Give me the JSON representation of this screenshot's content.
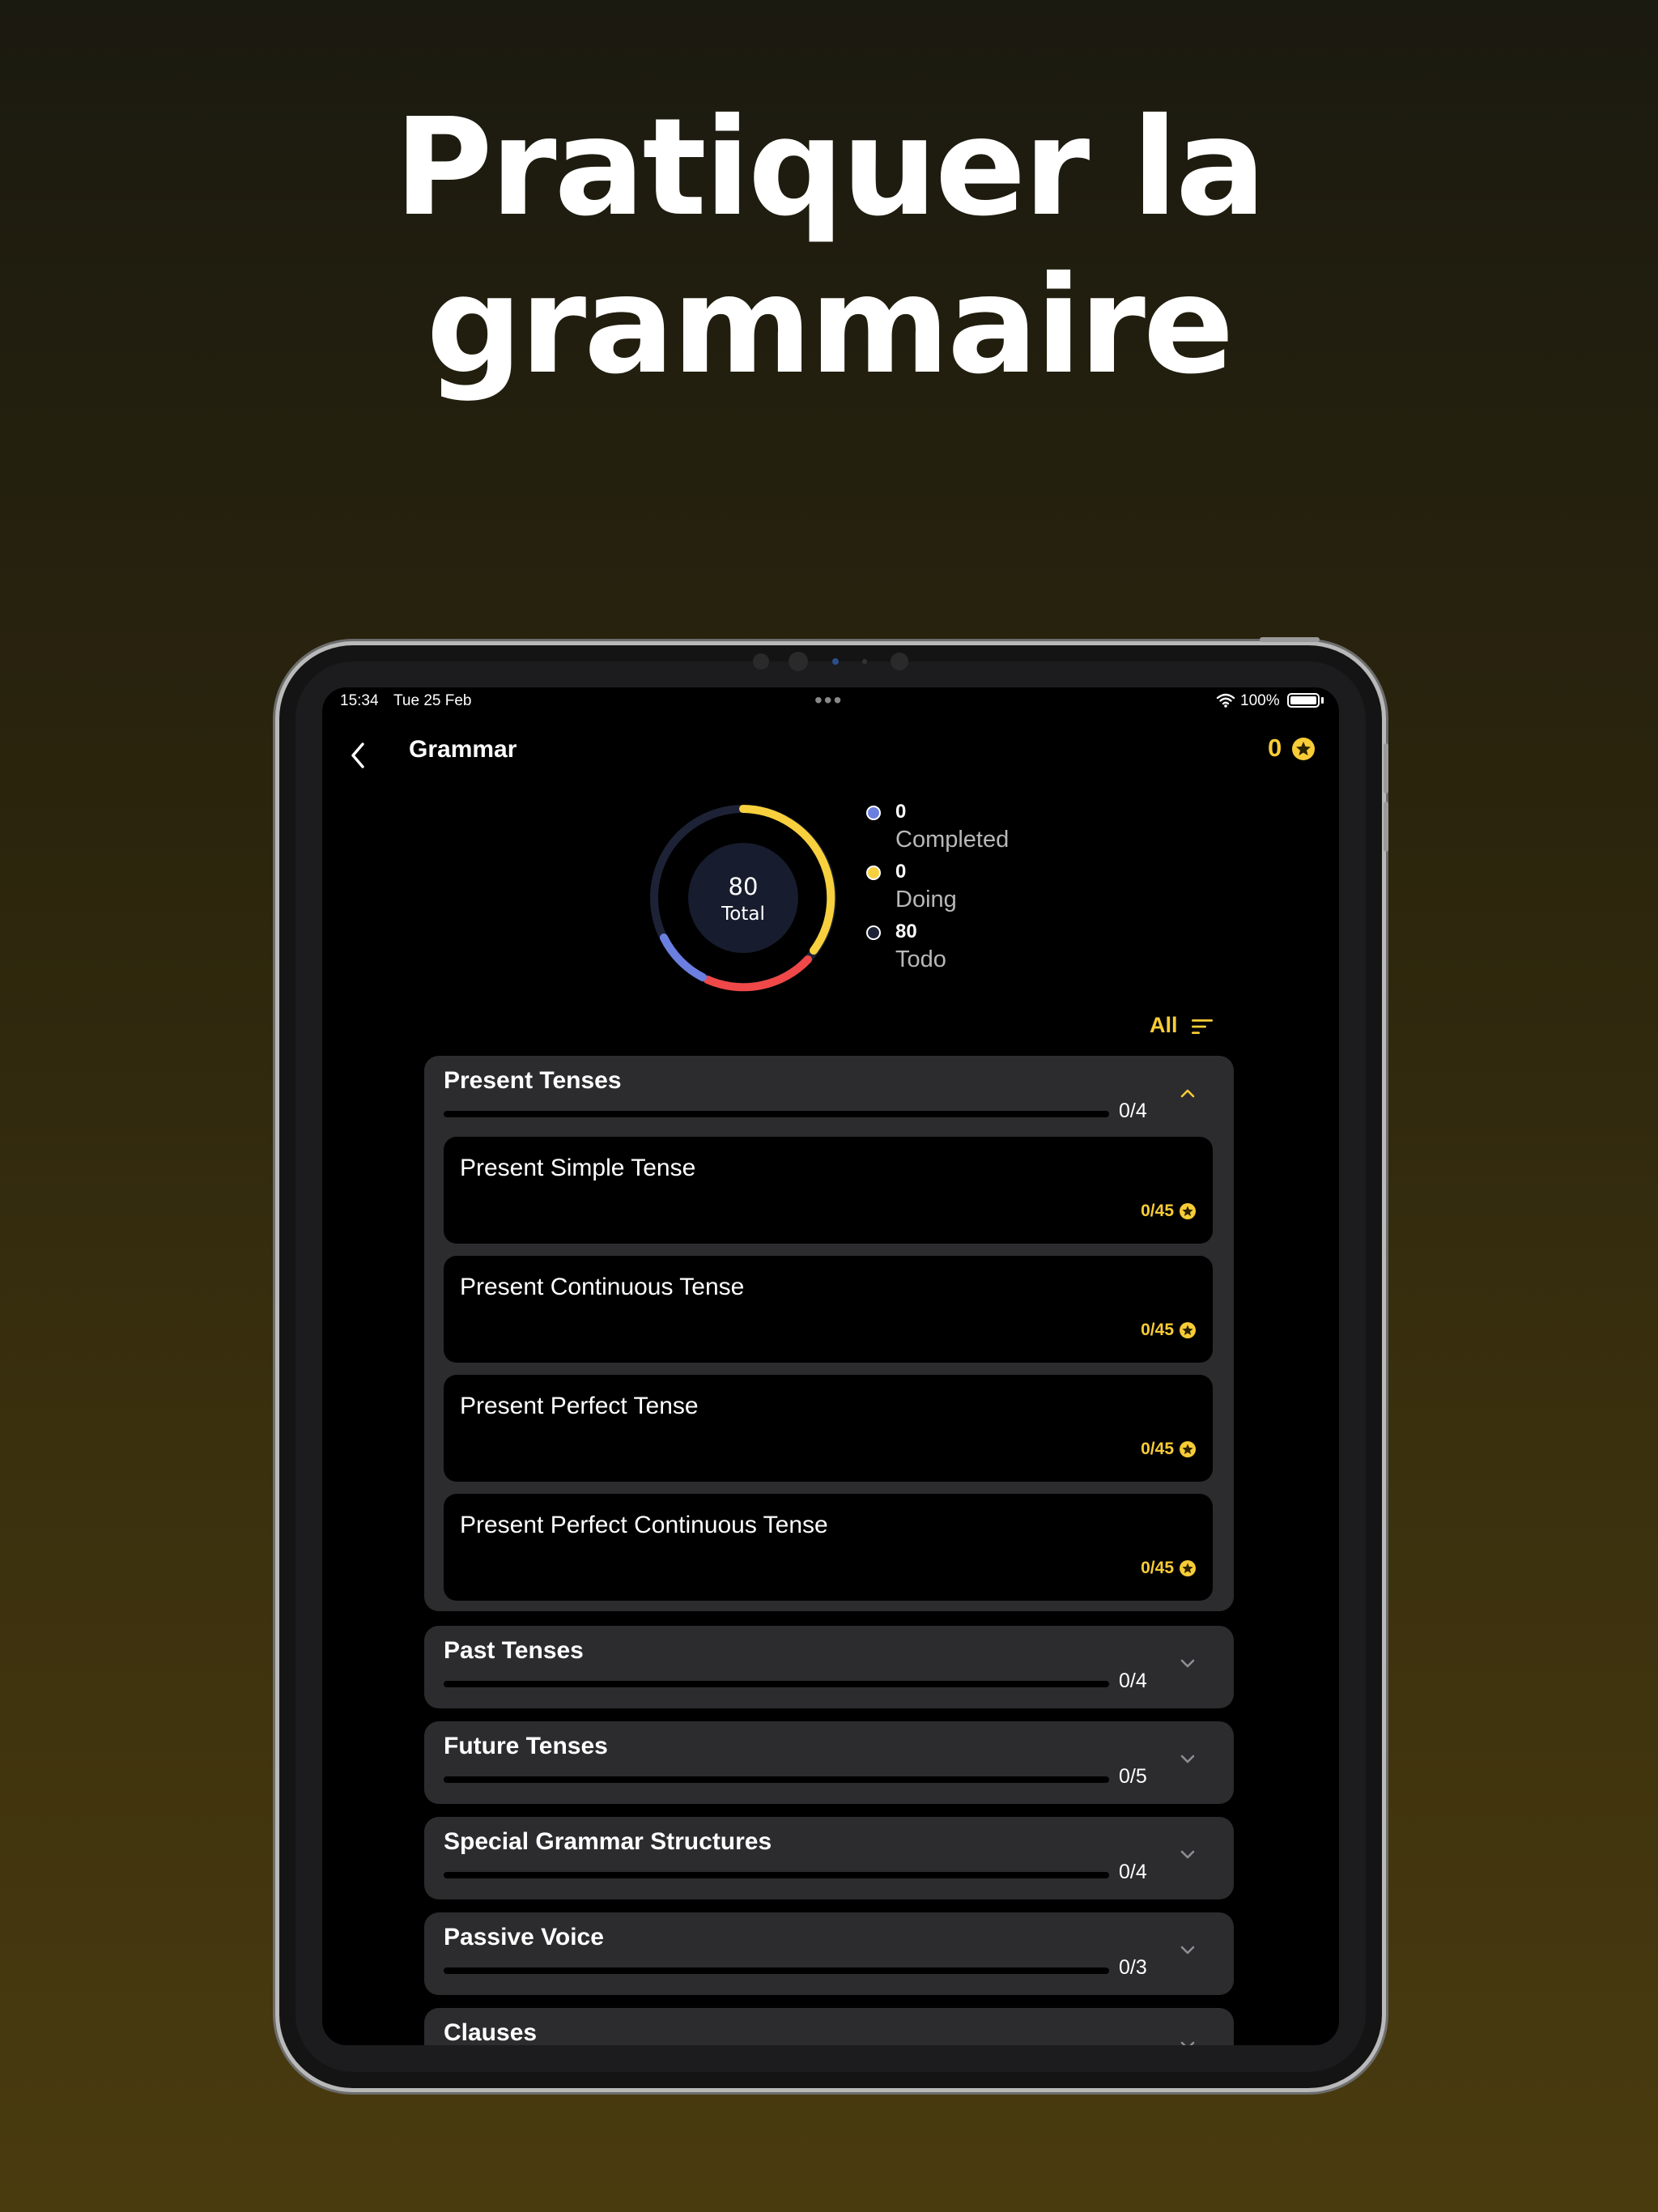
{
  "headline": [
    "Pratiquer la",
    "grammaire"
  ],
  "status_bar": {
    "time": "15:34",
    "date": "Tue 25 Feb",
    "dots": "•••",
    "battery": "100%"
  },
  "nav": {
    "title": "Grammar",
    "coins": "0"
  },
  "summary": {
    "total_value": "80",
    "total_label": "Total",
    "legend": [
      {
        "value": "0",
        "label": "Completed",
        "color": "#6b7fe0"
      },
      {
        "value": "0",
        "label": "Doing",
        "color": "#f8d03e"
      },
      {
        "value": "80",
        "label": "Todo",
        "color": "#1d2236"
      }
    ]
  },
  "filter": {
    "label": "All"
  },
  "sections": [
    {
      "title": "Present Tenses",
      "count": "0/4",
      "progress": 0,
      "expanded": true,
      "lessons": [
        {
          "title": "Present Simple Tense",
          "score": "0/45"
        },
        {
          "title": "Present Continuous Tense",
          "score": "0/45"
        },
        {
          "title": "Present Perfect Tense",
          "score": "0/45"
        },
        {
          "title": "Present Perfect Continuous Tense",
          "score": "0/45"
        }
      ]
    },
    {
      "title": "Past Tenses",
      "count": "0/4",
      "progress": 0,
      "expanded": false
    },
    {
      "title": "Future Tenses",
      "count": "0/5",
      "progress": 0,
      "expanded": false
    },
    {
      "title": "Special Grammar Structures",
      "count": "0/4",
      "progress": 0,
      "expanded": false
    },
    {
      "title": "Passive Voice",
      "count": "0/3",
      "progress": 0,
      "expanded": false
    },
    {
      "title": "Clauses",
      "count": "",
      "progress": 0,
      "expanded": false
    }
  ],
  "colors": {
    "accent": "#f8cc36",
    "card": "#2c2c2e",
    "ring_yellow": "#f8d03e",
    "ring_red": "#f04848",
    "ring_blue": "#6b7fe0",
    "ring_track": "#1d2236"
  }
}
